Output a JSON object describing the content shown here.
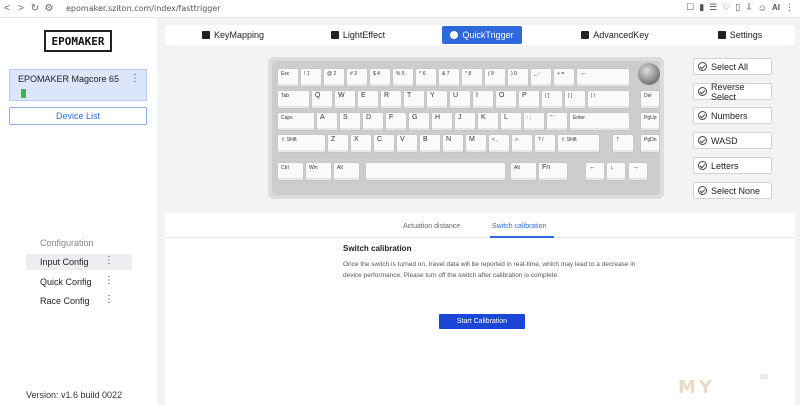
{
  "browser": {
    "url": "epomaker.sziton.com/index/fasttrigger",
    "ai_label": "AI"
  },
  "sidebar": {
    "logo": "EPOMAKER",
    "device_name": "EPOMAKER Magcore 65",
    "device_list_label": "Device List",
    "config_title": "Configuration",
    "config_items": [
      {
        "label": "Input Config"
      },
      {
        "label": "Quick Config"
      },
      {
        "label": "Race Config"
      }
    ],
    "version": "Version: v1.6 build 0022"
  },
  "tabs": [
    {
      "label": "KeyMapping",
      "icon": "keymap-icon"
    },
    {
      "label": "LightEffect",
      "icon": "light-icon"
    },
    {
      "label": "QuickTrigger",
      "icon": "trigger-icon"
    },
    {
      "label": "AdvancedKey",
      "icon": "advanced-icon"
    },
    {
      "label": "Settings",
      "icon": "gear-icon"
    }
  ],
  "select_options": [
    {
      "label": "Select All"
    },
    {
      "label": "Reverse Select"
    },
    {
      "label": "Numbers"
    },
    {
      "label": "WASD"
    },
    {
      "label": "Letters"
    },
    {
      "label": "Select None"
    }
  ],
  "keyboard": {
    "rows": [
      [
        "Esc",
        "! 1",
        "@ 2",
        "# 3",
        "$ 4",
        "% 5",
        "^ 6",
        "& 7",
        "* 8",
        "( 9",
        ") 0",
        "_ -",
        "+ =",
        "←"
      ],
      [
        "Tab",
        "Q",
        "W",
        "E",
        "R",
        "T",
        "Y",
        "U",
        "I",
        "O",
        "P",
        "{ [",
        "} ]",
        "| \\",
        "Del"
      ],
      [
        "Caps",
        "A",
        "S",
        "D",
        "F",
        "G",
        "H",
        "J",
        "K",
        "L",
        ": ;",
        "\" '",
        "Enter",
        "PgUp"
      ],
      [
        "⇧ Shift",
        "Z",
        "X",
        "C",
        "V",
        "B",
        "N",
        "M",
        "< ,",
        "> .",
        "? /",
        "⇧ Shift",
        "↑",
        "PgDn"
      ],
      [
        "Ctrl",
        "Win",
        "Alt",
        "",
        "Alt",
        "Fn",
        "←",
        "↓",
        "→"
      ]
    ]
  },
  "panel": {
    "tabs": [
      "Actuation distance",
      "Switch calibration"
    ],
    "active_tab": "Switch calibration",
    "title": "Switch calibration",
    "description": "Once the switch is turned on, travel data will be reported in real-time, which may lead to a decrease in device performance. Please turn off the switch after calibration is complete.",
    "start_button": "Start Calibration"
  },
  "watermark": {
    "text": "MY",
    "small": "ru"
  },
  "colors": {
    "accent": "#2f68dc",
    "button": "#1c46d8",
    "device_card": "#dbe6fb"
  }
}
